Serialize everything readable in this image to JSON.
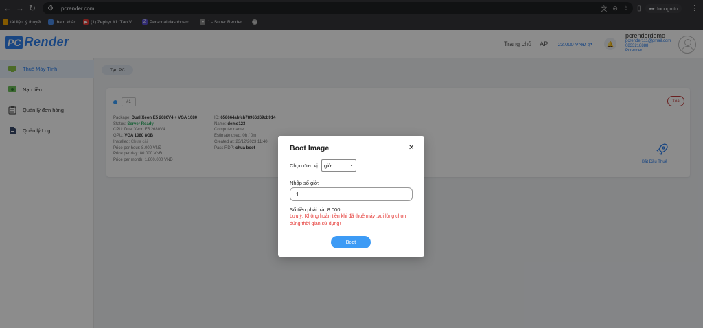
{
  "browser": {
    "url": "pcrender.com",
    "incognito_label": "Incognito",
    "bookmarks": [
      {
        "label": "tài liệu lý thuyết",
        "color": "#f0a500"
      },
      {
        "label": "tham khảo",
        "color": "#4a8ae8"
      },
      {
        "label": "(1) Zephyr #1: Tạo V...",
        "color": "#e53935"
      },
      {
        "label": "Personal dashboard...",
        "color": "#5a4fcf"
      },
      {
        "label": "1 - Super Render...",
        "color": "#888888"
      },
      {
        "label": "",
        "color": "#aaaaaa"
      }
    ]
  },
  "header": {
    "logo_pc": "PC",
    "logo_render": "Render",
    "nav_home": "Trang chủ",
    "nav_api": "API",
    "balance": "22.000 VNĐ",
    "user_name": "pcrenderdemo",
    "user_email": "pcrender111@gmail.com",
    "user_phone": "0833218888",
    "user_role": "Pcrender"
  },
  "sidebar": {
    "items": [
      {
        "label": "Thuê Máy Tính",
        "icon": "computer-icon",
        "active": true
      },
      {
        "label": "Nạp tiền",
        "icon": "money-icon",
        "active": false
      },
      {
        "label": "Quản lý đơn hàng",
        "icon": "clipboard-icon",
        "active": false
      },
      {
        "label": "Quản lý Log",
        "icon": "log-icon",
        "active": false
      }
    ]
  },
  "main": {
    "create_pc_label": "Tạo PC",
    "card": {
      "id_badge": "#1",
      "delete_label": "Xóa",
      "left": {
        "package_key": "Package:",
        "package_val": "Dual Xeon E5 2680V4 + VGA 1080",
        "status_key": "Status:",
        "status_val": "Server Ready",
        "cpu_key": "CPU:",
        "cpu_val": "Dual Xeon E5 2680V4",
        "gpu_key": "GPU:",
        "gpu_val": "VGA 1080 8GB",
        "installed_key": "Installed:",
        "installed_val": "Chưa cài",
        "price_hour_key": "Price per hour:",
        "price_hour_val": "8.000 VNĐ",
        "price_day_key": "Price per day:",
        "price_day_val": "80.000 VNĐ",
        "price_month_key": "Price per month:",
        "price_month_val": "1.800.000 VNĐ"
      },
      "right": {
        "id_key": "ID:",
        "id_val": "658664abfcb78966d69cb914",
        "name_key": "Name:",
        "name_val": "demo123",
        "computer_name_key": "Computer name:",
        "computer_name_val": "",
        "estimate_key": "Estimate used:",
        "estimate_val": "0h / 0m",
        "created_key": "Created at:",
        "created_val": "23/12/2023 11:40",
        "pass_key": "Pass RDP:",
        "pass_val": "chua boot"
      },
      "boot_action_label": "Bắt Đầu Thuê"
    }
  },
  "modal": {
    "title": "Boot Image",
    "close_glyph": "✕",
    "unit_label": "Chọn đơn vị:",
    "unit_selected": "giờ",
    "hours_label": "Nhập số giờ:",
    "hours_value": "1",
    "total_text": "Số tiền phải trả: 8.000",
    "warning": "Lưu ý: Không hoàn tiền khi đã thuê máy ,vui lòng chọn đúng thời gian sử dụng!",
    "boot_button": "Boot"
  }
}
